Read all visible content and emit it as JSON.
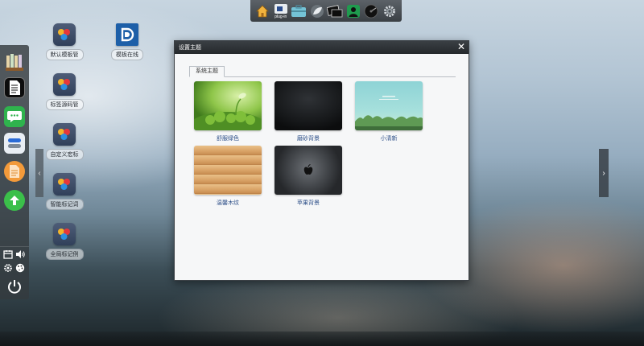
{
  "colors": {
    "window_title_bg": "#2c3034",
    "link_blue": "#2d4f88",
    "sidebar_bg": "#343a3e"
  },
  "top_dock": {
    "icons": [
      "home-icon",
      "plugin-icon",
      "toolbox-icon",
      "leaf-icon",
      "screen-icon",
      "user-icon",
      "disc-icon",
      "gear-icon"
    ],
    "plugin_text": "plug-in"
  },
  "sidebar": {
    "apps": [
      "books-icon",
      "document-icon",
      "chat-icon",
      "switch-icon",
      "notes-icon",
      "upload-icon"
    ],
    "bottom": [
      "calendar-icon",
      "volume-icon",
      "settings-icon",
      "palette-icon",
      "power-icon"
    ]
  },
  "desktop_icons": [
    {
      "label": "默认模板管"
    },
    {
      "label": "标签源码管"
    },
    {
      "label": "自定义宏标"
    },
    {
      "label": "智能标记词"
    },
    {
      "label": "全局标记例"
    }
  ],
  "desktop_app_right": {
    "label": "模板在线"
  },
  "window": {
    "title": "设置主题",
    "close": "✕",
    "tab": "系统主题",
    "themes": [
      {
        "label": "舒服绿色"
      },
      {
        "label": "磨砂背景"
      },
      {
        "label": "小清新"
      },
      {
        "label": "温馨木纹"
      },
      {
        "label": "苹果背景"
      }
    ]
  },
  "nav": {
    "left_arrow": "‹",
    "right_arrow": "›"
  }
}
